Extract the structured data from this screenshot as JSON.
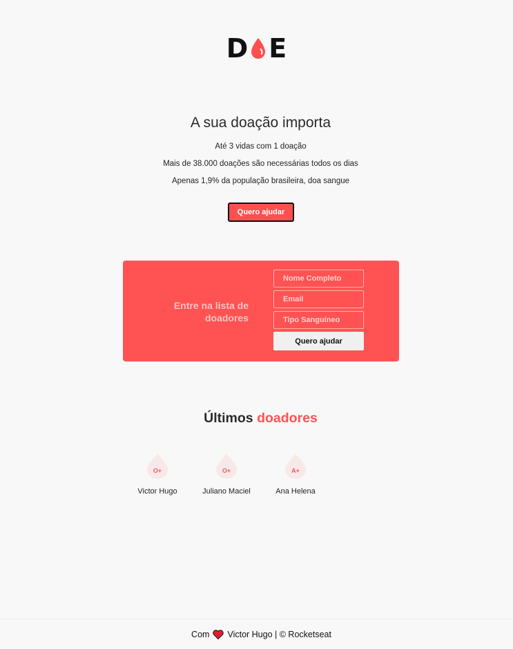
{
  "logo": {
    "letter_left": "D",
    "letter_right": "E",
    "icon": "blood-drop-icon",
    "color": "#111111",
    "accent": "#ff4f4f"
  },
  "hero": {
    "title": "A sua doação importa",
    "lines": [
      "Até 3 vidas com 1 doação",
      "Mais de 38.000 doações são necessárias todos os dias",
      "Apenas 1,9% da população brasileira, doa sangue"
    ],
    "button_label": "Quero ajudar"
  },
  "form": {
    "title_line1": "Entre na lista de",
    "title_line2": "doadores",
    "name_placeholder": "Nome Completo",
    "email_placeholder": "Email",
    "blood_placeholder": "Tipo Sanguíneo",
    "submit_label": "Quero ajudar",
    "background": "#ff5353"
  },
  "donors": {
    "title_prefix": "Últimos",
    "title_accent": "doadores",
    "items": [
      {
        "blood": "O+",
        "name": "Victor Hugo"
      },
      {
        "blood": "O+",
        "name": "Juliano Maciel"
      },
      {
        "blood": "A+",
        "name": "Ana Helena"
      }
    ]
  },
  "footer": {
    "prefix": "Com",
    "icon": "heart-icon",
    "text": "Victor Hugo | © Rocketseat"
  }
}
